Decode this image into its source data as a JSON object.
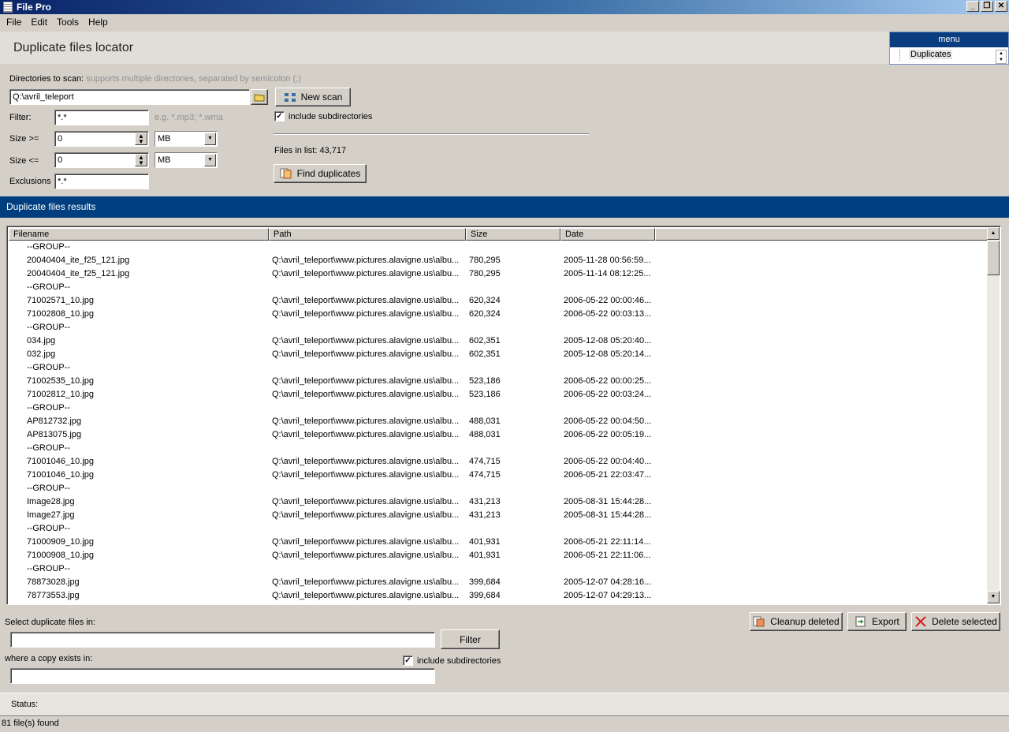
{
  "window": {
    "title": "File Pro"
  },
  "menu": [
    "File",
    "Edit",
    "Tools",
    "Help"
  ],
  "header": {
    "title": "Duplicate files locator"
  },
  "side_panel": {
    "title": "menu",
    "item": "Duplicates"
  },
  "scan": {
    "dirs_label": "Directories to scan:",
    "dirs_hint": "supports multiple directories, separated by semicolon (;)",
    "dirs_value": "Q:\\avril_teleport",
    "filter_label": "Filter:",
    "filter_value": "*.*",
    "filter_hint": "e.g. *.mp3; *.wma",
    "size_ge_label": "Size >=",
    "size_ge_value": "0",
    "size_ge_unit": "MB",
    "size_le_label": "Size <=",
    "size_le_value": "0",
    "size_le_unit": "MB",
    "exclusions_label": "Exclusions",
    "exclusions_value": "*.*",
    "new_scan_label": "New scan",
    "include_subdirs_label": "include subdirectories",
    "include_subdirs_checked": true,
    "files_in_list": "Files in list: 43,717",
    "find_duplicates_label": "Find duplicates"
  },
  "results": {
    "title": "Duplicate files results",
    "columns": [
      "Filename",
      "Path",
      "Size",
      "Date"
    ],
    "rows": [
      {
        "group": true,
        "filename": "--GROUP--"
      },
      {
        "filename": "20040404_ite_f25_121.jpg",
        "path": "Q:\\avril_teleport\\www.pictures.alavigne.us\\albu...",
        "size": "780,295",
        "date": "2005-11-28 00:56:59..."
      },
      {
        "filename": "20040404_ite_f25_121.jpg",
        "path": "Q:\\avril_teleport\\www.pictures.alavigne.us\\albu...",
        "size": "780,295",
        "date": "2005-11-14 08:12:25..."
      },
      {
        "group": true,
        "filename": "--GROUP--"
      },
      {
        "filename": "71002571_10.jpg",
        "path": "Q:\\avril_teleport\\www.pictures.alavigne.us\\albu...",
        "size": "620,324",
        "date": "2006-05-22 00:00:46..."
      },
      {
        "filename": "71002808_10.jpg",
        "path": "Q:\\avril_teleport\\www.pictures.alavigne.us\\albu...",
        "size": "620,324",
        "date": "2006-05-22 00:03:13..."
      },
      {
        "group": true,
        "filename": "--GROUP--"
      },
      {
        "filename": "034.jpg",
        "path": "Q:\\avril_teleport\\www.pictures.alavigne.us\\albu...",
        "size": "602,351",
        "date": "2005-12-08 05:20:40..."
      },
      {
        "filename": "032.jpg",
        "path": "Q:\\avril_teleport\\www.pictures.alavigne.us\\albu...",
        "size": "602,351",
        "date": "2005-12-08 05:20:14..."
      },
      {
        "group": true,
        "filename": "--GROUP--"
      },
      {
        "filename": "71002535_10.jpg",
        "path": "Q:\\avril_teleport\\www.pictures.alavigne.us\\albu...",
        "size": "523,186",
        "date": "2006-05-22 00:00:25..."
      },
      {
        "filename": "71002812_10.jpg",
        "path": "Q:\\avril_teleport\\www.pictures.alavigne.us\\albu...",
        "size": "523,186",
        "date": "2006-05-22 00:03:24..."
      },
      {
        "group": true,
        "filename": "--GROUP--"
      },
      {
        "filename": "AP812732.jpg",
        "path": "Q:\\avril_teleport\\www.pictures.alavigne.us\\albu...",
        "size": "488,031",
        "date": "2006-05-22 00:04:50..."
      },
      {
        "filename": "AP813075.jpg",
        "path": "Q:\\avril_teleport\\www.pictures.alavigne.us\\albu...",
        "size": "488,031",
        "date": "2006-05-22 00:05:19..."
      },
      {
        "group": true,
        "filename": "--GROUP--"
      },
      {
        "filename": "71001046_10.jpg",
        "path": "Q:\\avril_teleport\\www.pictures.alavigne.us\\albu...",
        "size": "474,715",
        "date": "2006-05-22 00:04:40..."
      },
      {
        "filename": "71001046_10.jpg",
        "path": "Q:\\avril_teleport\\www.pictures.alavigne.us\\albu...",
        "size": "474,715",
        "date": "2006-05-21 22:03:47..."
      },
      {
        "group": true,
        "filename": "--GROUP--"
      },
      {
        "filename": "Image28.jpg",
        "path": "Q:\\avril_teleport\\www.pictures.alavigne.us\\albu...",
        "size": "431,213",
        "date": "2005-08-31 15:44:28..."
      },
      {
        "filename": "Image27.jpg",
        "path": "Q:\\avril_teleport\\www.pictures.alavigne.us\\albu...",
        "size": "431,213",
        "date": "2005-08-31 15:44:28..."
      },
      {
        "group": true,
        "filename": "--GROUP--"
      },
      {
        "filename": "71000909_10.jpg",
        "path": "Q:\\avril_teleport\\www.pictures.alavigne.us\\albu...",
        "size": "401,931",
        "date": "2006-05-21 22:11:14..."
      },
      {
        "filename": "71000908_10.jpg",
        "path": "Q:\\avril_teleport\\www.pictures.alavigne.us\\albu...",
        "size": "401,931",
        "date": "2006-05-21 22:11:06..."
      },
      {
        "group": true,
        "filename": "--GROUP--"
      },
      {
        "filename": "78873028.jpg",
        "path": "Q:\\avril_teleport\\www.pictures.alavigne.us\\albu...",
        "size": "399,684",
        "date": "2005-12-07 04:28:16..."
      },
      {
        "filename": "78773553.jpg",
        "path": "Q:\\avril_teleport\\www.pictures.alavigne.us\\albu...",
        "size": "399,684",
        "date": "2005-12-07 04:29:13..."
      }
    ]
  },
  "actions": {
    "cleanup_label": "Cleanup deleted",
    "export_label": "Export",
    "delete_label": "Delete selected"
  },
  "selection": {
    "select_in_label": "Select duplicate files in:",
    "select_in_value": "",
    "filter_button": "Filter",
    "copy_exists_label": "where a copy exists in:",
    "copy_exists_value": "",
    "include_subdirs_label": "include subdirectories",
    "include_subdirs_checked": true
  },
  "status": {
    "label": "Status:",
    "message": "81 file(s) found"
  },
  "colors": {
    "accent": "#003f7f",
    "panel": "#d4d0c8"
  }
}
